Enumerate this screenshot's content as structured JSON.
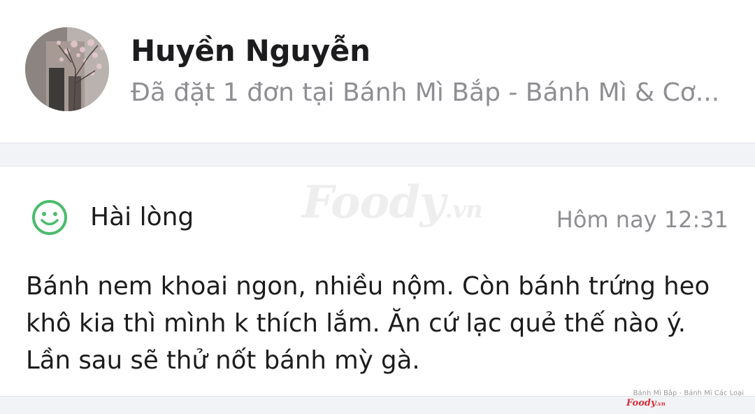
{
  "header": {
    "user_name": "Huyền Nguyễn",
    "order_info": "Đã đặt 1 đơn tại Bánh Mì Bắp - Bánh Mì & Cơ..."
  },
  "review": {
    "rating_label": "Hài lòng",
    "rating_icon": "smile-face-icon",
    "timestamp": "Hôm nay 12:31",
    "text": "Bánh nem khoai ngon, nhiều nộm. Còn bánh trứng heo khô kia thì mình k thích lắm. Ăn cứ lạc quẻ thế nào ý. Lần sau sẽ thử nốt bánh mỳ gà."
  },
  "watermark": {
    "brand": "Foody",
    "suffix": ".vn"
  },
  "footer": {
    "source_caption": "Bánh Mì Bắp - Bánh Mì Các Loại",
    "logo_brand": "Foody",
    "logo_suffix": ".vn"
  },
  "colors": {
    "rating_green": "#4cbb6c",
    "logo_red": "#d6303a",
    "muted_text": "#8e8e93",
    "separator_bg": "#f2f3f7"
  }
}
